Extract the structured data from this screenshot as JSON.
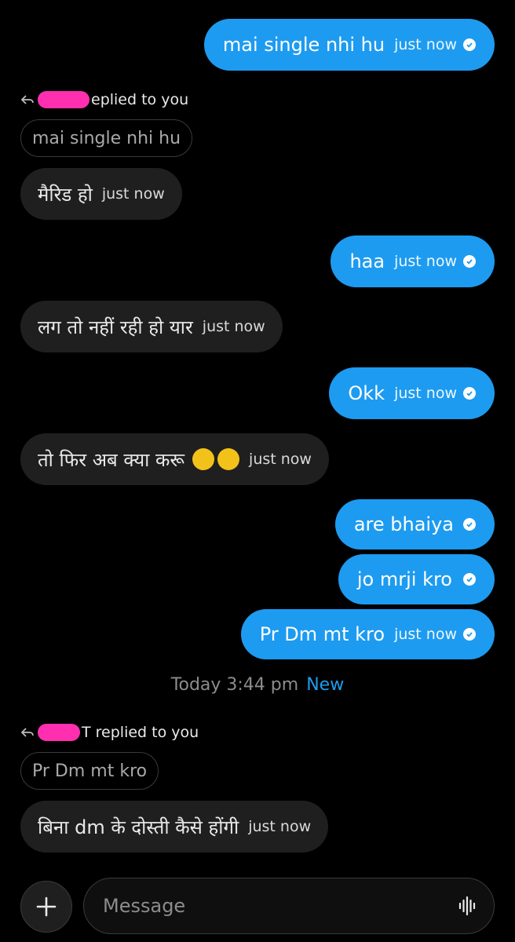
{
  "colors": {
    "accent": "#1d9bf0",
    "incoming_bubble": "#1f1f1f",
    "background": "#000000",
    "redaction": "#ff2fb0"
  },
  "messages": [
    {
      "text": "mai single nhi hu",
      "time": "just now"
    },
    {
      "reply_label": "eplied to you",
      "quoted": "mai single nhi hu",
      "text": "मैरिड हो",
      "time": "just now"
    },
    {
      "text": "haa",
      "time": "just now"
    },
    {
      "text": "लग तो नहीं रही हो यार",
      "time": "just now"
    },
    {
      "text": "Okk",
      "time": "just now"
    },
    {
      "text": "तो फिर अब क्या करू",
      "time": "just now",
      "emoji": [
        "slightly-smiling-face",
        "smiling-face-with-tear"
      ]
    },
    {
      "text": "are bhaiya"
    },
    {
      "text": "jo mrji kro"
    },
    {
      "text": "Pr Dm mt kro",
      "time": "just now"
    },
    {
      "reply_label": "T replied to you",
      "quoted": "Pr Dm mt kro",
      "text": "बिना dm के दोस्ती कैसे होंगी",
      "time": "just now"
    }
  ],
  "divider": {
    "time": "Today 3:44 pm",
    "new_label": "New"
  },
  "composer": {
    "placeholder": "Message",
    "left_icon": "plus-icon",
    "right_icon": "voice-waveform-icon"
  }
}
